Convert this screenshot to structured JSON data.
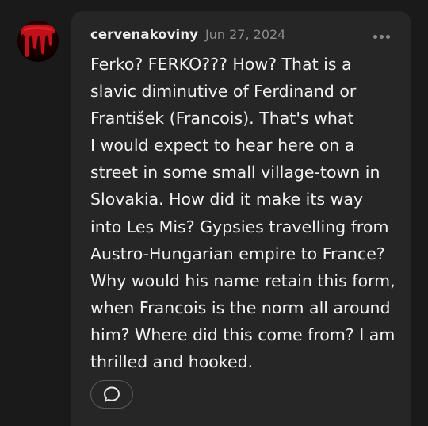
{
  "post": {
    "username": "cervenakoviny",
    "date": "Jun 27, 2024",
    "body_lines": [
      "Ferko? FERKO??? How? That is a",
      "slavic diminutive of Ferdinand or",
      "František (Francois). That's what",
      "I would expect to hear here on a",
      "street in some small village-town in",
      "Slovakia. How did it make its way",
      "into Les Mis? Gypsies travelling from",
      "Austro-Hungarian empire to France?",
      "Why would his name retain this form,",
      "when Francois is the norm all around",
      "him? Where did this come from? I am",
      "thrilled and hooked."
    ]
  },
  "icons": {
    "avatar": "red-dripping-avatar-icon",
    "more": "more-horizontal-icon",
    "reply": "speech-bubble-icon"
  },
  "colors": {
    "background": "#1a1a1a",
    "card": "#262626",
    "text": "#f2f2f2",
    "muted": "#8c8c8c",
    "avatar_red": "#c0111a"
  }
}
